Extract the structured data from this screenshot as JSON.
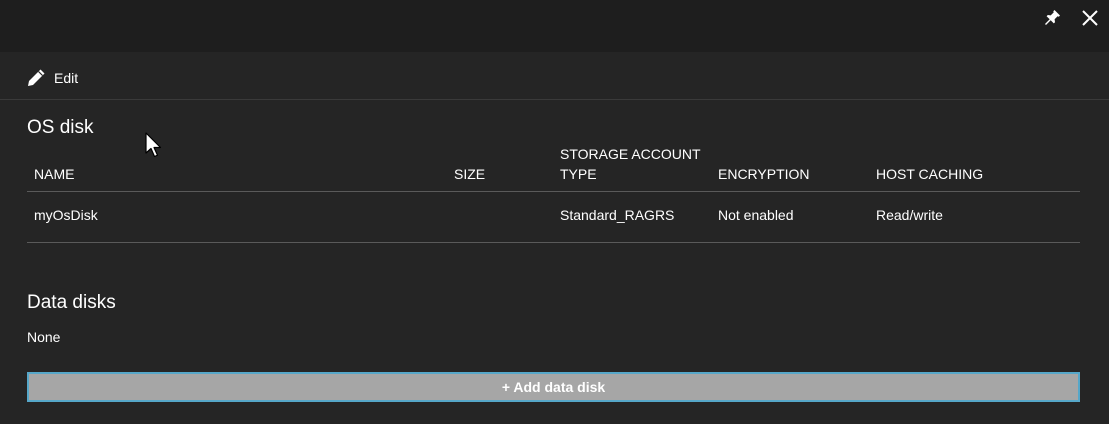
{
  "header": {
    "icons": [
      "pin-icon",
      "close-icon"
    ]
  },
  "toolbar": {
    "edit_label": "Edit",
    "edit_icon": "pencil-icon"
  },
  "os_disk": {
    "title": "OS disk",
    "columns": {
      "name": "NAME",
      "size": "SIZE",
      "type_line1": "STORAGE ACCOUNT",
      "type_line2": "TYPE",
      "encryption": "ENCRYPTION",
      "host_caching": "HOST CACHING"
    },
    "rows": [
      {
        "name": "myOsDisk",
        "size": "",
        "storage_type": "Standard_RAGRS",
        "encryption": "Not enabled",
        "host_caching": "Read/write"
      }
    ]
  },
  "data_disks": {
    "title": "Data disks",
    "empty_text": "None",
    "add_button_label": "+ Add data disk"
  },
  "colors": {
    "background": "#252525",
    "titlebar": "#1e1e1e",
    "button_fill": "#a6a6a6",
    "button_border": "#56a7c9",
    "divider": "#5a5a5a"
  }
}
